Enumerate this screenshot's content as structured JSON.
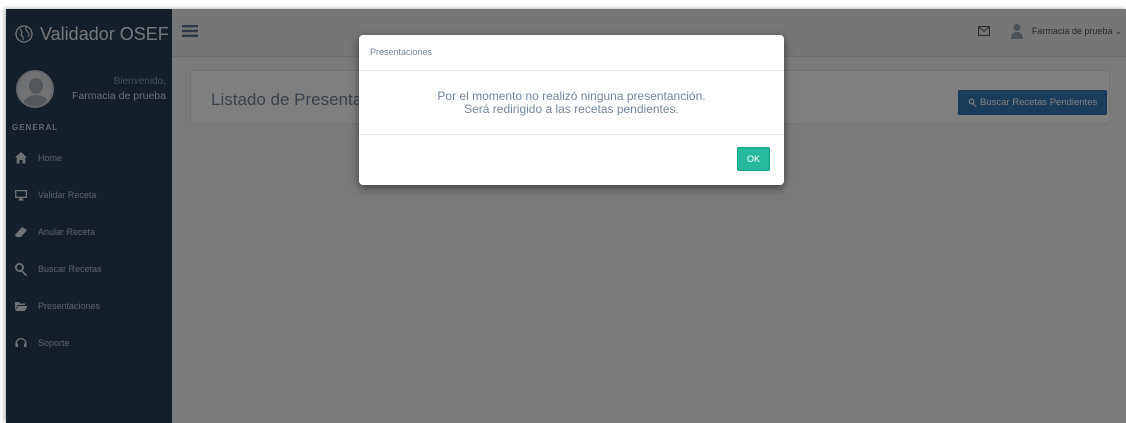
{
  "brand": {
    "title": "Validador OSEF",
    "icon": "globe-icon"
  },
  "profile": {
    "welcome": "Bienvenido,",
    "name": "Farmacia de prueba"
  },
  "sidebar": {
    "section_title": "GENERAL",
    "items": [
      {
        "label": "Home",
        "icon": "home-icon"
      },
      {
        "label": "Validar Receta",
        "icon": "desktop-icon"
      },
      {
        "label": "Anular Receta",
        "icon": "eraser-icon"
      },
      {
        "label": "Buscar Recetas",
        "icon": "search-icon"
      },
      {
        "label": "Presentaciones",
        "icon": "folder-open-icon"
      },
      {
        "label": "Soporte",
        "icon": "headset-icon"
      }
    ]
  },
  "topnav": {
    "user_name": "Farmacia de prueba",
    "user_caret": "⌄"
  },
  "main": {
    "page_title": "Listado de Presentaciones",
    "search_button": "Buscar Recetas Pendientes"
  },
  "modal": {
    "title": "Presentaciones",
    "line1": "Por el momento no realizó ninguna presentanción.",
    "line2": "Será redirigido a las recetas pendientes.",
    "ok_label": "OK"
  },
  "colors": {
    "sidebar_bg": "#2a3f54",
    "primary_button": "#337ab7",
    "success_button": "#26b99a",
    "text_muted": "#73879c"
  }
}
